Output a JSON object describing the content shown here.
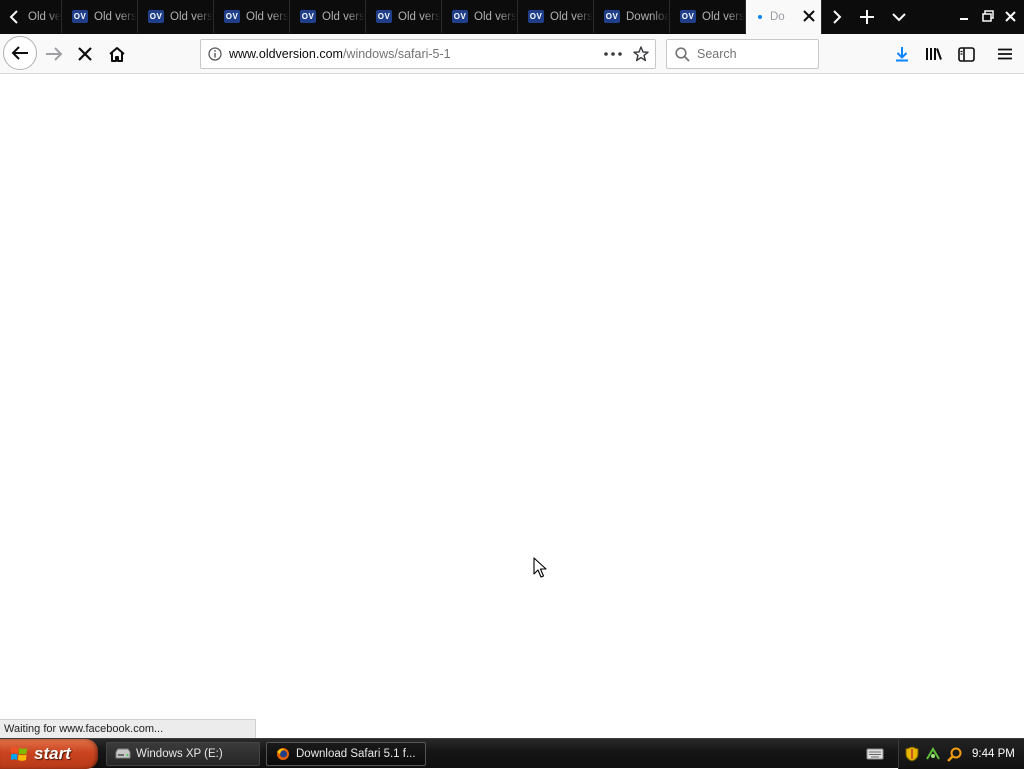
{
  "tabs": [
    {
      "favicon": "",
      "title": "Old version"
    },
    {
      "favicon": "OV",
      "title": "Old version"
    },
    {
      "favicon": "OV",
      "title": "Old version"
    },
    {
      "favicon": "OV",
      "title": "Old version"
    },
    {
      "favicon": "OV",
      "title": "Old version"
    },
    {
      "favicon": "OV",
      "title": "Old version"
    },
    {
      "favicon": "OV",
      "title": "Old version"
    },
    {
      "favicon": "OV",
      "title": "Old version"
    },
    {
      "favicon": "OV",
      "title": "Download"
    },
    {
      "favicon": "OV",
      "title": "Old version"
    },
    {
      "favicon": "",
      "title": "Do"
    }
  ],
  "active_tab_title": "Do",
  "navbar": {
    "url_host": "www.oldversion.com",
    "url_path": "/windows/safari-5-1",
    "search_placeholder": "Search"
  },
  "status": {
    "text": "Waiting for www.facebook.com..."
  },
  "taskbar": {
    "start_label": "start",
    "items": [
      {
        "label": "Windows XP (E:)",
        "icon": "drive-icon"
      },
      {
        "label": "Download Safari 5.1 f...",
        "icon": "firefox-icon"
      }
    ],
    "clock": "9:44 PM"
  },
  "colors": {
    "tabstrip": "#0c0c0d",
    "favicon_bg": "#1f3f8a",
    "accent": "#0a84ff",
    "start_button": "#c9441f"
  }
}
